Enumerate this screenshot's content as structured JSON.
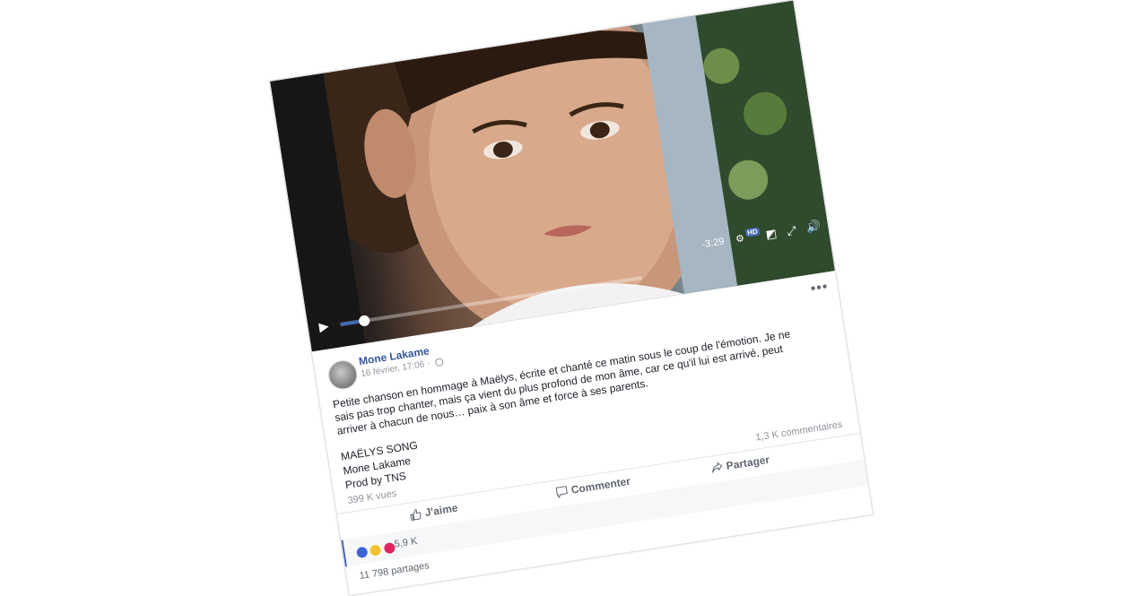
{
  "video": {
    "time_remaining": "-3:29",
    "quality_badge": "HD",
    "progress": 0.08
  },
  "post": {
    "author": "Mone Lakame",
    "date": "16 février, 17:06 ·",
    "text": "Petite chanson en hommage à Maëlys, écrite et chanté ce matin sous le coup de l'émotion. Je ne sais pas trop chanter, mais ça vient du plus profond de mon âme, car ce qu'il lui est arrivé, peut arriver à chacun de nous… paix à son âme et force à ses parents.",
    "song_lines": [
      "MAËLYS SONG",
      "Mone Lakame",
      "Prod by TNS"
    ],
    "views": "399 K vues",
    "comments_count": "1,3 K commentaires"
  },
  "actions": {
    "like": "J'aime",
    "comment": "Commenter",
    "share": "Partager"
  },
  "reactions": {
    "count": "5,9 K",
    "icons": [
      "like-reaction",
      "haha-reaction",
      "love-reaction"
    ]
  },
  "shares": "11 798 partages",
  "colors": {
    "author": "#365899",
    "accent": "#4267b2"
  }
}
